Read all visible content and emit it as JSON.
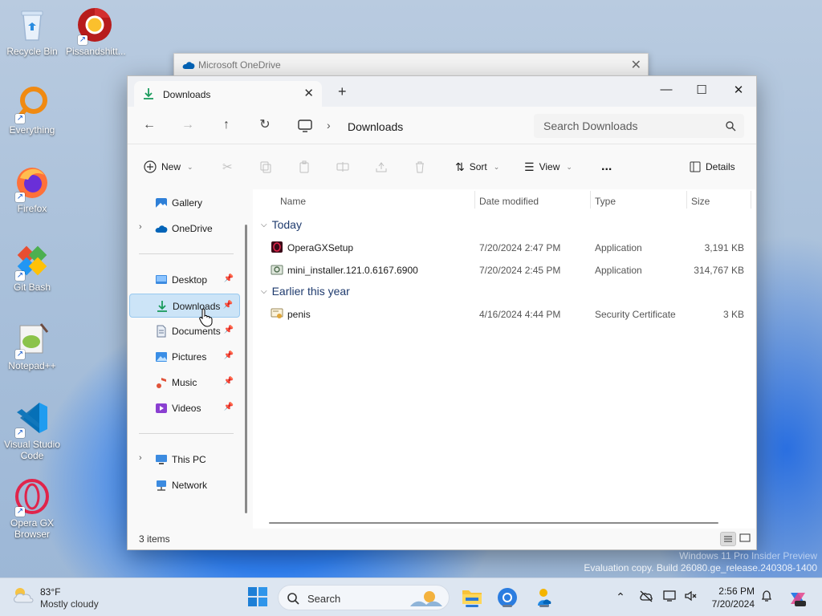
{
  "desktop": {
    "icons": [
      {
        "label": "Recycle Bin"
      },
      {
        "label": "Pissandshitt..."
      },
      {
        "label": "Everything"
      },
      {
        "label": "Firefox"
      },
      {
        "label": "Git Bash"
      },
      {
        "label": "Notepad++"
      },
      {
        "label": "Visual Studio Code"
      },
      {
        "label": "Opera GX Browser"
      }
    ]
  },
  "onedrive_window": {
    "title": "Microsoft OneDrive"
  },
  "explorer": {
    "tab_label": "Downloads",
    "address_path": "Downloads",
    "search_placeholder": "Search Downloads",
    "toolbar": {
      "new_label": "New",
      "sort_label": "Sort",
      "view_label": "View",
      "more_label": "...",
      "details_label": "Details"
    },
    "sidebar": {
      "items": [
        {
          "label": "Gallery"
        },
        {
          "label": "OneDrive"
        },
        {
          "label": "Desktop"
        },
        {
          "label": "Downloads"
        },
        {
          "label": "Documents"
        },
        {
          "label": "Pictures"
        },
        {
          "label": "Music"
        },
        {
          "label": "Videos"
        },
        {
          "label": "This PC"
        },
        {
          "label": "Network"
        }
      ]
    },
    "columns": {
      "name": "Name",
      "date": "Date modified",
      "type": "Type",
      "size": "Size"
    },
    "groups": [
      {
        "label": "Today",
        "files": [
          {
            "name": "OperaGXSetup",
            "date": "7/20/2024 2:47 PM",
            "type": "Application",
            "size": "3,191 KB"
          },
          {
            "name": "mini_installer.121.0.6167.6900",
            "date": "7/20/2024 2:45 PM",
            "type": "Application",
            "size": "314,767 KB"
          }
        ]
      },
      {
        "label": "Earlier this year",
        "files": [
          {
            "name": "penis",
            "date": "4/16/2024 4:44 PM",
            "type": "Security Certificate",
            "size": "3 KB"
          }
        ]
      }
    ],
    "status_count": "3 items"
  },
  "watermark": {
    "line1": "Windows 11 Pro Insider Preview",
    "line2": "Evaluation copy. Build 26080.ge_release.240308-1400"
  },
  "taskbar": {
    "weather_temp": "83°F",
    "weather_condition": "Mostly cloudy",
    "search_label": "Search",
    "time": "2:56 PM",
    "date": "7/20/2024"
  },
  "colors": {
    "accent": "#0067c0",
    "selection": "#cce4f7",
    "folder": "#f8c33a"
  }
}
